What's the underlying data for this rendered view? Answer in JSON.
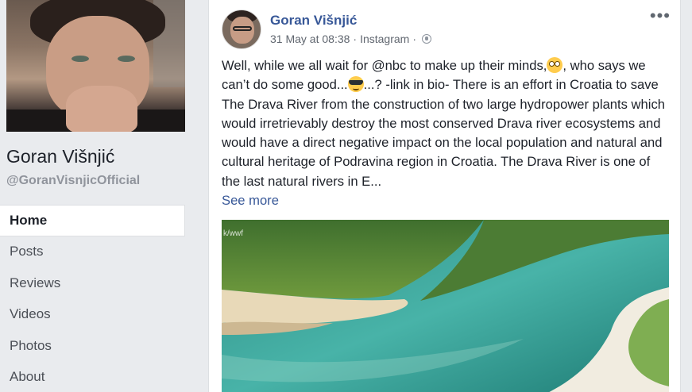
{
  "page": {
    "name": "Goran Višnjić",
    "handle": "@GoranVisnjicOfficial"
  },
  "nav": [
    {
      "label": "Home",
      "active": true
    },
    {
      "label": "Posts"
    },
    {
      "label": "Reviews"
    },
    {
      "label": "Videos"
    },
    {
      "label": "Photos"
    },
    {
      "label": "About"
    }
  ],
  "post": {
    "author": "Goran Višnjić",
    "date": "31 May at 08:38",
    "separator": "·",
    "source": "Instagram",
    "privacy_icon": "globe-icon",
    "text_part1": "Well, while we all wait for @nbc to make up their minds,",
    "emoji1": "flushed-emoji",
    "text_part2": ", who says we can’t do some good...",
    "emoji2": "sunglasses-emoji",
    "text_part3": "...? -link in bio- There is an effort in Croatia to save The Drava River from the construction of two large hydropower plants which would irretrievably destroy the most conserved Drava river ecosystems and would have a direct negative impact on the local population and natural and cultural heritage of Podravina region in Croatia. The Drava River is one of the last natural rivers in E...",
    "see_more": "See more",
    "image_watermark": "k/wwf"
  },
  "colors": {
    "link": "#385898",
    "background": "#e9ebee"
  }
}
